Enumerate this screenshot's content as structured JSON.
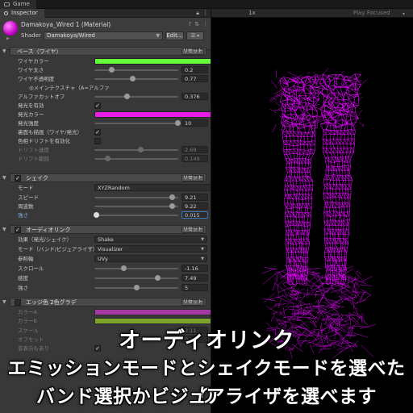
{
  "game_tab": {
    "label": "Game",
    "zoom": "1x",
    "play_mode": "Play Focused"
  },
  "inspector": {
    "tab_label": "Inspector",
    "material_name": "Damakoya_Wired 1 (Material)",
    "shader_label": "Shader",
    "shader_value": "Damakoya/Wired",
    "edit_label": "Edit...",
    "menu_label": "☰ ▾"
  },
  "reset_label": "リセット",
  "sections": {
    "base": {
      "title": "ベース（ワイヤ）"
    },
    "shake": {
      "title": "シェイク"
    },
    "audio": {
      "title": "オーディオリンク"
    },
    "edge": {
      "title": "エッジ色 2色グラデ"
    }
  },
  "base_rows": {
    "wire_color": "ワイヤカラー",
    "wire_width": {
      "label": "ワイヤ太さ",
      "value": "0.2",
      "level": 0.2
    },
    "wire_alpha": {
      "label": "ワイヤ不透明度",
      "value": "0.77",
      "level": 0.45
    },
    "main_tex": "◎メインテクスチャ（A=アルファ",
    "alpha_cutoff": {
      "label": "アルファカットオフ",
      "value": "0.376",
      "level": 0.38
    },
    "emit_enable": "発光を有効",
    "emit_color": "発光カラー",
    "emit_strength": {
      "label": "発光強度",
      "value": "10",
      "level": 0.99
    },
    "backface": "裏面も描画（ワイヤ/発光）",
    "hue_drift": "色相ドリフトを有効化",
    "drift_speed": {
      "label": "ドリフト速度",
      "value": "2.69",
      "level": 0.55
    },
    "drift_range": {
      "label": "ドリフト範囲",
      "value": "0.149",
      "level": 0.15
    }
  },
  "shake_rows": {
    "mode": {
      "label": "モード",
      "value": "XYZRandom"
    },
    "speed": {
      "label": "スピード",
      "value": "9.21",
      "level": 0.92
    },
    "frequency": {
      "label": "周波数",
      "value": "9.22",
      "level": 0.92
    },
    "strength": {
      "label": "強さ",
      "value": "0.015",
      "level": 0.02
    }
  },
  "audio_rows": {
    "effect": {
      "label": "効果（発光/シェイク）",
      "value": "Shake"
    },
    "band_mode": {
      "label": "モード（バンド/ビジュアライザ）",
      "value": "Visualizer"
    },
    "ref_axis": {
      "label": "参照軸",
      "value": "UVy"
    },
    "scroll": {
      "label": "スクロール",
      "value": "-1.16",
      "level": 0.35
    },
    "sensitivity": {
      "label": "感度",
      "value": "7.49",
      "level": 0.75
    },
    "strength": {
      "label": "強さ",
      "value": "5",
      "level": 0.5
    }
  },
  "edge_rows": {
    "color_a": "カラーA",
    "color_b": "カラーB",
    "scale": {
      "label": "スケール",
      "value": "2.11"
    },
    "offset": {
      "label": "オフセット",
      "value": "0"
    },
    "extra": {
      "label": "非表示もあり",
      "value": ""
    }
  },
  "colors": {
    "wire": "#66ff3c",
    "emit": "#e81ee8",
    "edge_a": "#ff3cff",
    "edge_b": "#b4ff1e",
    "wire_render": "#e400ff"
  },
  "caption": {
    "line1": "オーディオリンク",
    "line2": "エミッションモードとシェイクモードを選べたり",
    "line3": "バンド選択かビジュアライザを選べます"
  }
}
